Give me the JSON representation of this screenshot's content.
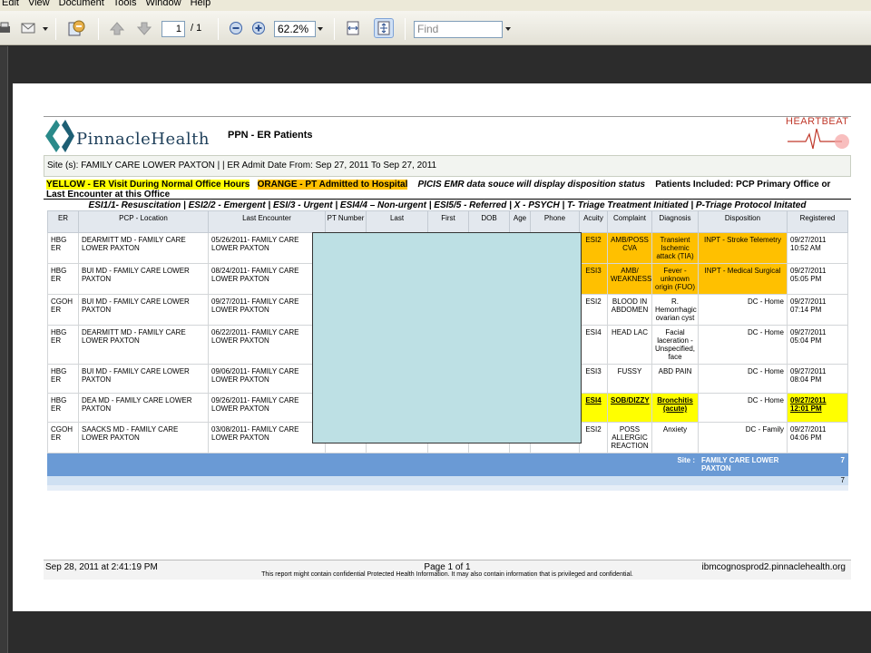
{
  "menu": [
    "Edit",
    "View",
    "Document",
    "Tools",
    "Window",
    "Help"
  ],
  "toolbar": {
    "page_current": "1",
    "page_total": "/ 1",
    "zoom": "62.2%",
    "find_placeholder": "Find"
  },
  "report": {
    "logo_text": "PinnacleHealth",
    "title": "PPN - ER Patients",
    "heartbeat_label": "HEARTBEAT",
    "site_line": "Site (s): FAMILY CARE LOWER PAXTON | | ER Admit Date From:  Sep 27, 2011 To Sep 27, 2011",
    "legend": {
      "yellow": "YELLOW - ER Visit During Normal Office Hours",
      "orange": "ORANGE - PT Admitted to Hospital",
      "picis": "PICIS EMR data souce will display disposition status",
      "included": "Patients Included:  PCP Primary Office or Last Encounter at this Office"
    },
    "esi_line": "ESI1/1- Resuscitation | ESI2/2 - Emergent | ESI/3 - Urgent | ESI4/4 – Non-urgent | ESI5/5 - Referred  | X - PSYCH  | T- Triage Treatment Initiated  | P-Triage Protocol Initated",
    "columns": [
      "ER",
      "PCP - Location",
      "Last Encounter",
      "PT Number",
      "Last",
      "First",
      "DOB",
      "Age",
      "Phone",
      "Acuity",
      "Complaint",
      "Diagnosis",
      "Disposition",
      "Registered"
    ],
    "rows": [
      {
        "er": "HBG ER",
        "pcp": "DEARMITT MD - FAMILY CARE LOWER PAXTON",
        "last_enc": "05/26/2011- FAMILY CARE LOWER PAXTON",
        "acuity": "ESI2",
        "complaint": "AMB/POSS CVA",
        "diagnosis": "Transient Ischemic attack (TIA)",
        "disposition": "INPT - Stroke Telemetry",
        "registered": "09/27/2011 10:52 AM"
      },
      {
        "er": "HBG ER",
        "pcp": "BUI MD - FAMILY CARE LOWER PAXTON",
        "last_enc": "08/24/2011- FAMILY CARE LOWER PAXTON",
        "acuity": "ESI3",
        "complaint": "AMB/ WEAKNESS",
        "diagnosis": "Fever - unknown origin (FUO)",
        "disposition": "INPT - Medical Surgical",
        "registered": "09/27/2011 05:05 PM"
      },
      {
        "er": "CGOH ER",
        "pcp": "BUI MD - FAMILY CARE LOWER PAXTON",
        "last_enc": "09/27/2011- FAMILY CARE LOWER PAXTON",
        "acuity": "ESI2",
        "complaint": "BLOOD IN ABDOMEN",
        "diagnosis": "R. Hemorrhagic ovarian cyst",
        "disposition": "DC - Home",
        "registered": "09/27/2011 07:14 PM"
      },
      {
        "er": "HBG ER",
        "pcp": "DEARMITT MD - FAMILY CARE LOWER PAXTON",
        "last_enc": "06/22/2011- FAMILY CARE LOWER PAXTON",
        "acuity": "ESI4",
        "complaint": "HEAD LAC",
        "diagnosis": "Facial laceration - Unspecified, face",
        "disposition": "DC - Home",
        "registered": "09/27/2011 05:04 PM"
      },
      {
        "er": "HBG ER",
        "pcp": "BUI MD - FAMILY CARE LOWER PAXTON",
        "last_enc": "09/06/2011- FAMILY CARE LOWER PAXTON",
        "acuity": "ESI3",
        "complaint": "FUSSY",
        "diagnosis": "ABD PAIN",
        "disposition": "DC - Home",
        "registered": "09/27/2011 08:04 PM"
      },
      {
        "er": "HBG ER",
        "pcp": "DEA MD - FAMILY CARE LOWER PAXTON",
        "last_enc": "09/26/2011- FAMILY CARE LOWER PAXTON",
        "acuity": "ESI4",
        "complaint": "SOB/DIZZY",
        "diagnosis": "Bronchitis (acute)",
        "disposition": "DC - Home",
        "registered": "09/27/2011 12:01 PM"
      },
      {
        "er": "CGOH ER",
        "pcp": "SAACKS MD - FAMILY CARE LOWER PAXTON",
        "last_enc": "03/08/2011- FAMILY CARE LOWER PAXTON",
        "acuity": "ESI2",
        "complaint": "POSS ALLERGIC REACTION",
        "diagnosis": "Anxiety",
        "disposition": "DC - Family",
        "registered": "09/27/2011 04:06 PM"
      }
    ],
    "summary": {
      "label": "Site :",
      "site": "FAMILY CARE LOWER PAXTON",
      "count": "7",
      "total": "7"
    },
    "footer": {
      "timestamp": "Sep 28, 2011 at 2:41:19 PM",
      "page": "Page 1 of 1",
      "server": "ibmcognosprod2.pinnaclehealth.org",
      "confidential": "This report might contain confidential Protected Health Information. It may also contain information that is privileged and confidential."
    }
  }
}
